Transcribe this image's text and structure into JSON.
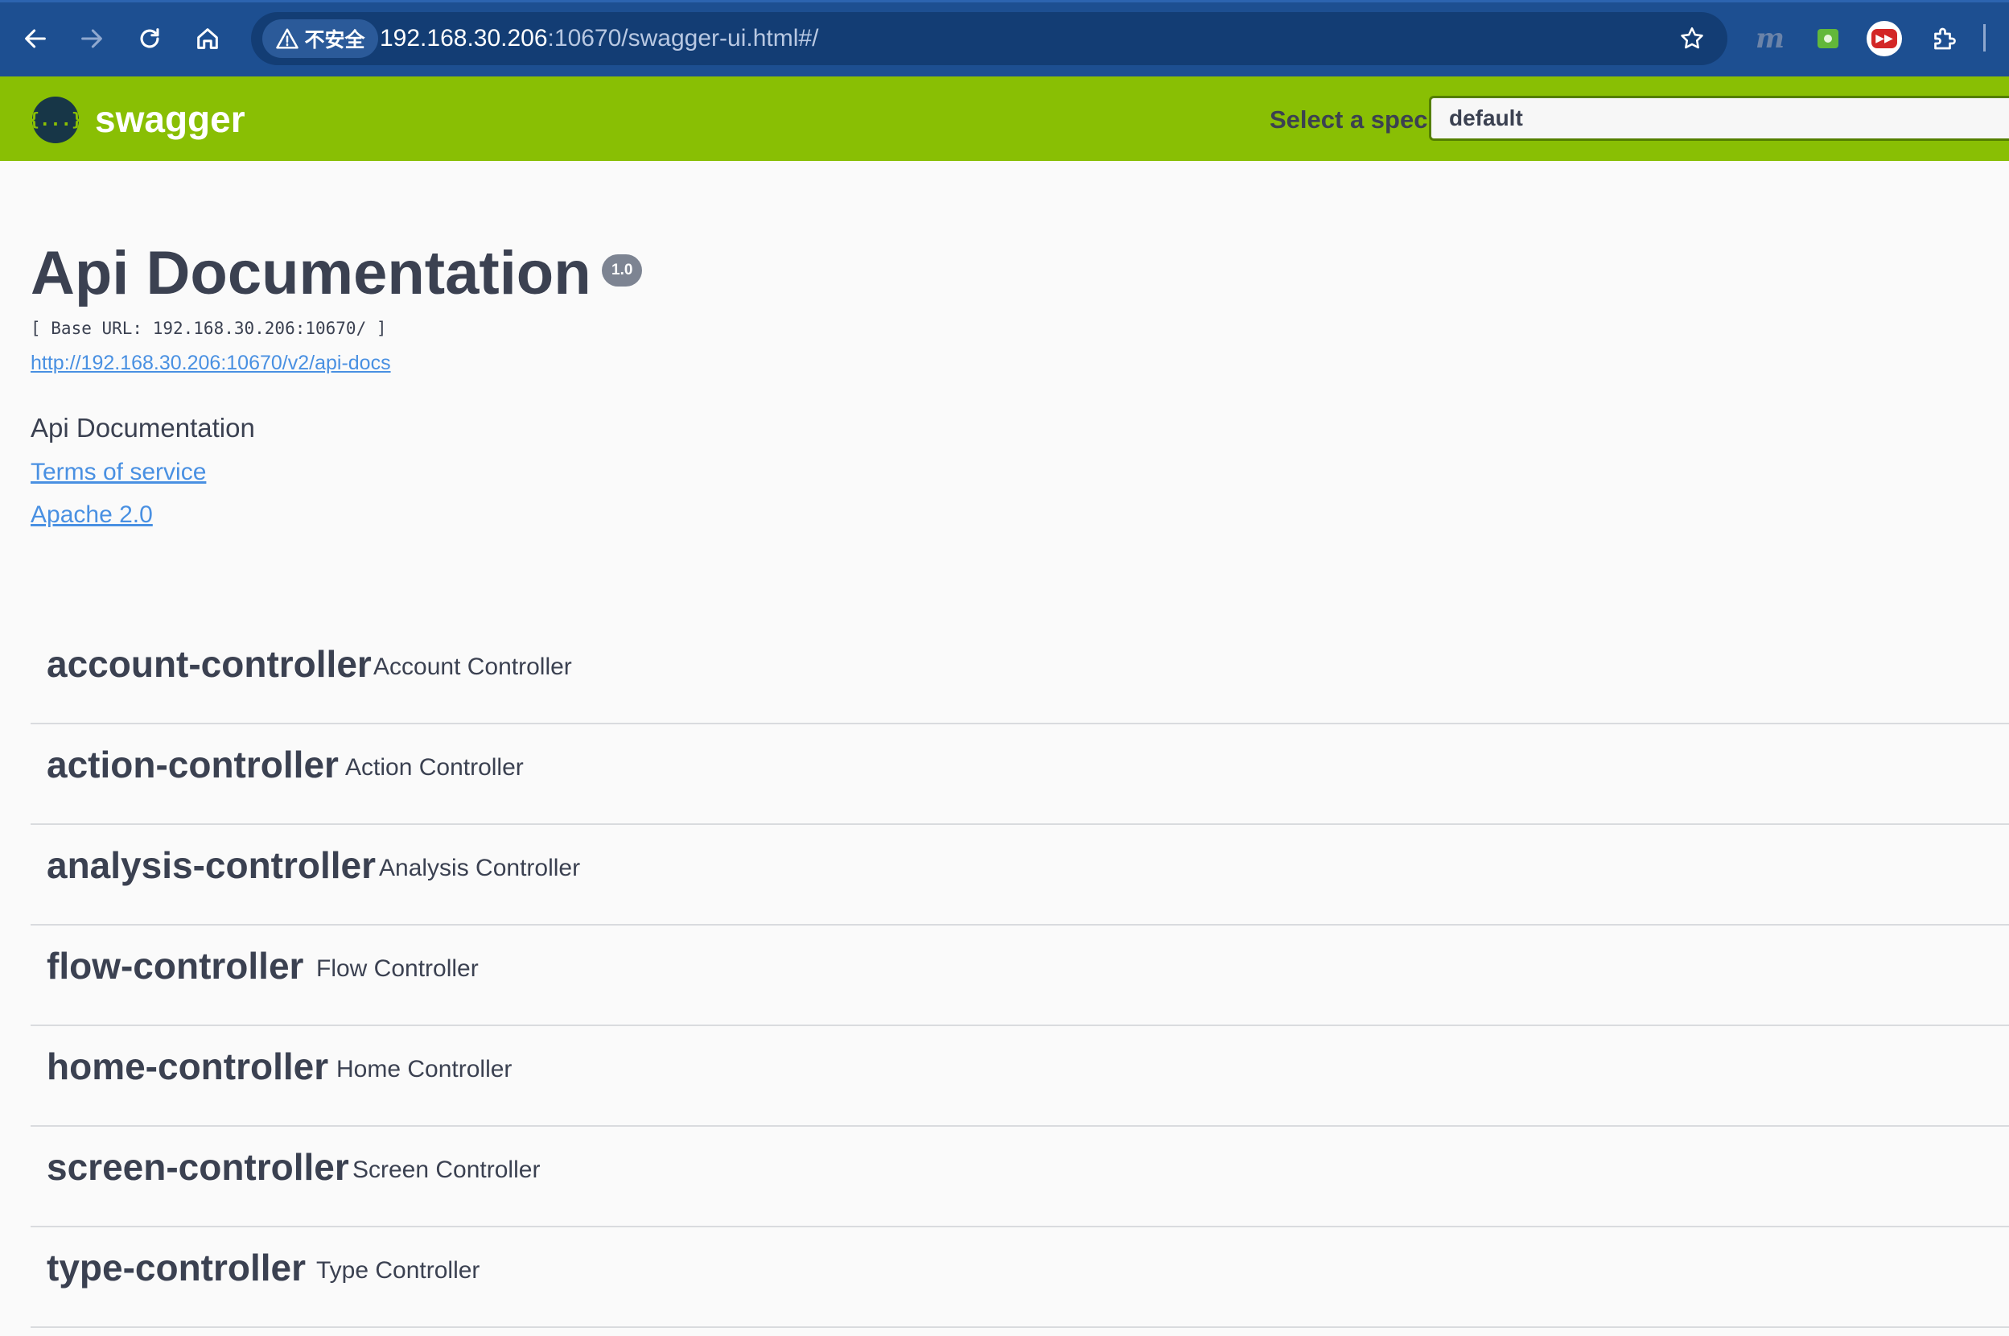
{
  "browser": {
    "security_label": "不安全",
    "url_host": "192.168.30.206",
    "url_path": ":10670/swagger-ui.html#/",
    "extension_m_label": "m",
    "icons": [
      "back-icon",
      "forward-icon",
      "reload-icon",
      "home-icon",
      "warning-icon",
      "star-icon",
      "puzzle-icon"
    ]
  },
  "topbar": {
    "logo_glyph": "{...}",
    "brand": "swagger",
    "spec_label": "Select a spec",
    "spec_value": "default",
    "colors": {
      "bar": "#89bf04",
      "logo_bg": "#173647"
    }
  },
  "info": {
    "title": "Api Documentation",
    "version": "1.0",
    "base_url": "[ Base URL: 192.168.30.206:10670/ ]",
    "api_docs_url": "http://192.168.30.206:10670/v2/api-docs",
    "description": "Api Documentation",
    "terms": "Terms of service",
    "license": "Apache 2.0",
    "link_color": "#4990e2"
  },
  "tags": [
    {
      "name": "account-controller",
      "description": "Account Controller"
    },
    {
      "name": "action-controller",
      "description": "Action Controller"
    },
    {
      "name": "analysis-controller",
      "description": "Analysis Controller"
    },
    {
      "name": "flow-controller",
      "description": "Flow Controller"
    },
    {
      "name": "home-controller",
      "description": "Home Controller"
    },
    {
      "name": "screen-controller",
      "description": "Screen Controller"
    },
    {
      "name": "type-controller",
      "description": "Type Controller"
    }
  ]
}
